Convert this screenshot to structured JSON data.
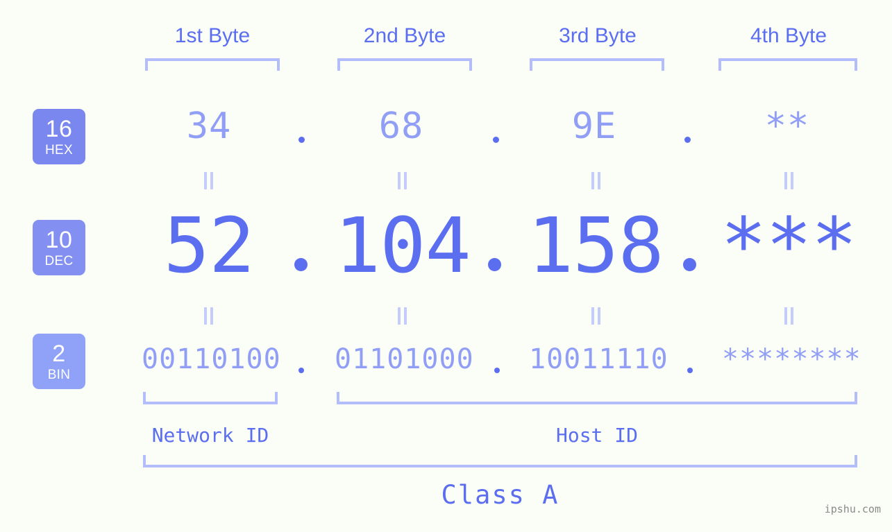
{
  "background_color": "#fbfdf7",
  "accent_color": "#5b6ef0",
  "accent_light_color": "#919ef5",
  "bracket_color": "#b3bdfb",
  "byte_headers": [
    {
      "label": "1st Byte"
    },
    {
      "label": "2nd Byte"
    },
    {
      "label": "3rd Byte"
    },
    {
      "label": "4th Byte"
    }
  ],
  "bases": [
    {
      "number": "16",
      "name": "HEX",
      "color": "#7a87ef"
    },
    {
      "number": "10",
      "name": "DEC",
      "color": "#8390f2"
    },
    {
      "number": "2",
      "name": "BIN",
      "color": "#8fa2f8"
    }
  ],
  "rows": {
    "hex": {
      "values": [
        "34",
        "68",
        "9E",
        "**"
      ],
      "separator": "."
    },
    "dec": {
      "values": [
        "52",
        "104",
        "158",
        "***"
      ],
      "separator": "."
    },
    "bin": {
      "values": [
        "00110100",
        "01101000",
        "10011110",
        "********"
      ],
      "separator": "."
    }
  },
  "equals_marks": [
    "=",
    "=",
    "=",
    "=",
    "=",
    "=",
    "=",
    "="
  ],
  "segments": {
    "network_id": "Network ID",
    "host_id": "Host ID",
    "class": "Class A"
  },
  "watermark": "ipshu.com"
}
